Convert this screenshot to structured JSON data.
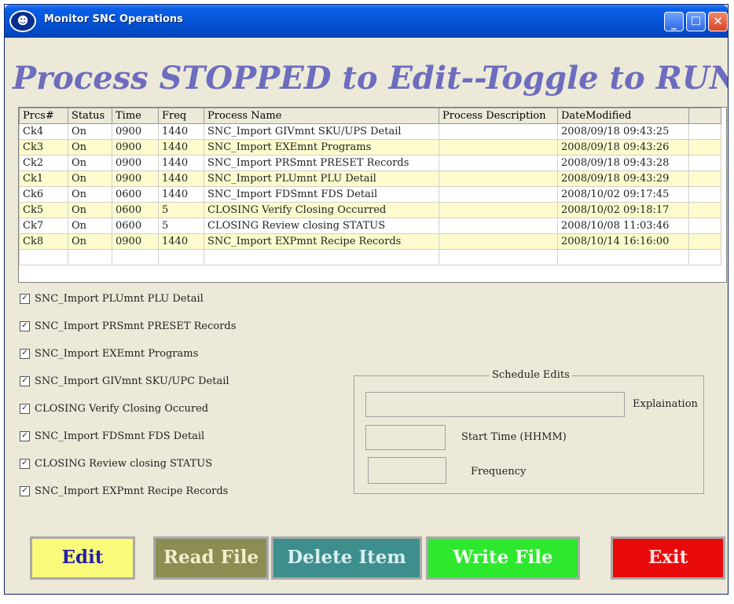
{
  "window": {
    "title": "Monitor SNC Operations"
  },
  "banner": "Process STOPPED to Edit--Toggle to RUN",
  "table": {
    "headers": [
      "Prcs#",
      "Status",
      "Time",
      "Freq",
      "Process Name",
      "Process Description",
      "DateModified"
    ],
    "rows": [
      [
        "Ck4",
        "On",
        "0900",
        "1440",
        "SNC_Import GIVmnt SKU/UPS Detail",
        "",
        "2008/09/18 09:43:25"
      ],
      [
        "Ck3",
        "On",
        "0900",
        "1440",
        "SNC_Import EXEmnt Programs",
        "",
        "2008/09/18 09:43:26"
      ],
      [
        "Ck2",
        "On",
        "0900",
        "1440",
        "SNC_Import PRSmnt PRESET Records",
        "",
        "2008/09/18 09:43:28"
      ],
      [
        "Ck1",
        "On",
        "0900",
        "1440",
        "SNC_Import PLUmnt PLU Detail",
        "",
        "2008/09/18 09:43:29"
      ],
      [
        "Ck6",
        "On",
        "0600",
        "1440",
        "SNC_Import FDSmnt FDS Detail",
        "",
        "2008/10/02 09:17:45"
      ],
      [
        "Ck5",
        "On",
        "0600",
        "5",
        "CLOSING  Verify Closing Occurred",
        "",
        "2008/10/02 09:18:17"
      ],
      [
        "Ck7",
        "On",
        "0600",
        "5",
        "CLOSING  Review closing STATUS",
        "",
        "2008/10/08 11:03:46"
      ],
      [
        "Ck8",
        "On",
        "0900",
        "1440",
        "SNC_Import EXPmnt Recipe Records",
        "",
        "2008/10/14 16:16:00"
      ]
    ]
  },
  "checks": [
    {
      "label": "SNC_Import PLUmnt PLU Detail",
      "checked": true
    },
    {
      "label": "SNC_Import PRSmnt PRESET Records",
      "checked": true
    },
    {
      "label": "SNC_Import EXEmnt Programs",
      "checked": true
    },
    {
      "label": "SNC_Import GIVmnt SKU/UPC Detail",
      "checked": true
    },
    {
      "label": "CLOSING  Verify Closing Occured",
      "checked": true
    },
    {
      "label": "SNC_Import FDSmnt FDS Detail",
      "checked": true
    },
    {
      "label": "CLOSING  Review closing STATUS",
      "checked": true
    },
    {
      "label": "SNC_Import EXPmnt Recipe Records",
      "checked": true
    }
  ],
  "schedule": {
    "title": "Schedule Edits",
    "explanation_label": "Explaination",
    "start_label": "Start Time (HHMM)",
    "frequency_label": "Frequency",
    "explanation_value": "",
    "start_value": "",
    "frequency_value": ""
  },
  "buttons": {
    "edit": "Edit",
    "read": "Read File",
    "delete": "Delete Item",
    "write": "Write File",
    "exit": "Exit"
  },
  "colors": {
    "banner": "#6c6dbe",
    "row_highlight": "#fbfbcd",
    "edit": "#fafa7a",
    "read": "#8d8c53",
    "delete": "#3e8e8e",
    "write": "#2ee82e",
    "exit": "#e80a0a"
  }
}
